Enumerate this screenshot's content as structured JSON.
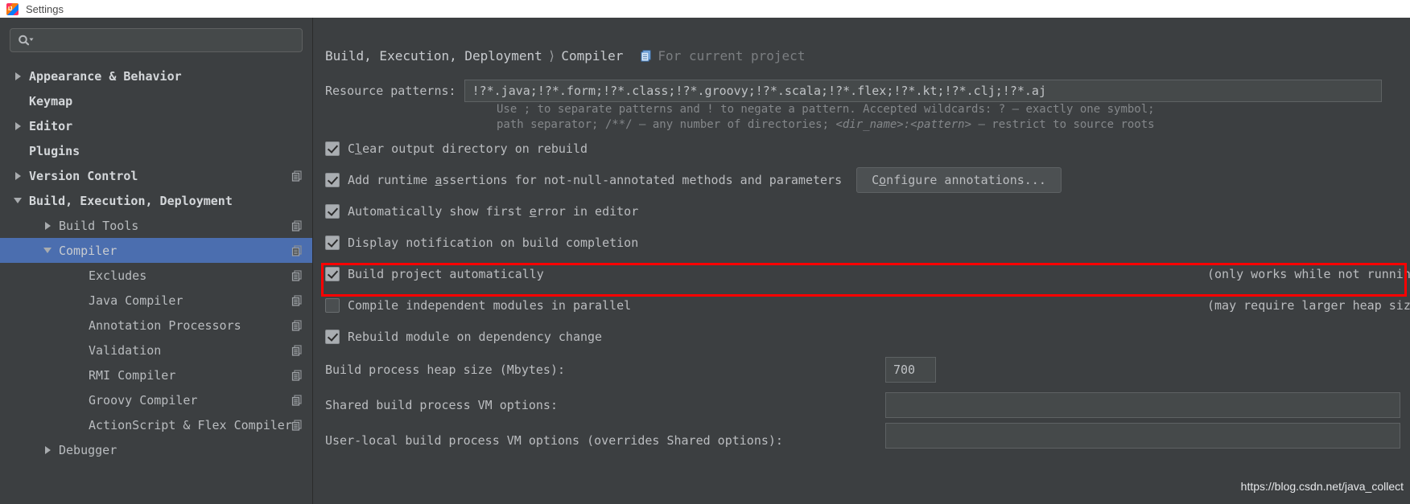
{
  "window": {
    "title": "Settings",
    "app_icon": "intellij-idea-logo"
  },
  "sidebar": {
    "search": {
      "placeholder": "",
      "value": "",
      "icon": "search-icon"
    },
    "items": [
      {
        "label": "Appearance & Behavior",
        "arrow": "right",
        "indent": 0,
        "bold": true,
        "selected": false,
        "badge": false
      },
      {
        "label": "Keymap",
        "arrow": "none",
        "indent": 0,
        "bold": true,
        "selected": false,
        "badge": false
      },
      {
        "label": "Editor",
        "arrow": "right",
        "indent": 0,
        "bold": true,
        "selected": false,
        "badge": false
      },
      {
        "label": "Plugins",
        "arrow": "none",
        "indent": 0,
        "bold": true,
        "selected": false,
        "badge": false
      },
      {
        "label": "Version Control",
        "arrow": "right",
        "indent": 0,
        "bold": true,
        "selected": false,
        "badge": true
      },
      {
        "label": "Build, Execution, Deployment",
        "arrow": "down",
        "indent": 0,
        "bold": true,
        "selected": false,
        "badge": false
      },
      {
        "label": "Build Tools",
        "arrow": "right",
        "indent": 1,
        "bold": false,
        "selected": false,
        "badge": true
      },
      {
        "label": "Compiler",
        "arrow": "down",
        "indent": 1,
        "bold": false,
        "selected": true,
        "badge": true
      },
      {
        "label": "Excludes",
        "arrow": "none",
        "indent": 2,
        "bold": false,
        "selected": false,
        "badge": true
      },
      {
        "label": "Java Compiler",
        "arrow": "none",
        "indent": 2,
        "bold": false,
        "selected": false,
        "badge": true
      },
      {
        "label": "Annotation Processors",
        "arrow": "none",
        "indent": 2,
        "bold": false,
        "selected": false,
        "badge": true
      },
      {
        "label": "Validation",
        "arrow": "none",
        "indent": 2,
        "bold": false,
        "selected": false,
        "badge": true
      },
      {
        "label": "RMI Compiler",
        "arrow": "none",
        "indent": 2,
        "bold": false,
        "selected": false,
        "badge": true
      },
      {
        "label": "Groovy Compiler",
        "arrow": "none",
        "indent": 2,
        "bold": false,
        "selected": false,
        "badge": true
      },
      {
        "label": "ActionScript & Flex Compiler",
        "arrow": "none",
        "indent": 2,
        "bold": false,
        "selected": false,
        "badge": true
      },
      {
        "label": "Debugger",
        "arrow": "right",
        "indent": 1,
        "bold": false,
        "selected": false,
        "badge": false
      }
    ]
  },
  "breadcrumb": {
    "root": "Build, Execution, Deployment",
    "separator": "⟩",
    "leaf": "Compiler",
    "scope_icon": "project-scope-icon",
    "scope_text": "For current project"
  },
  "form": {
    "resource_patterns_label": "Resource patterns:",
    "resource_patterns_value": "!?*.java;!?*.form;!?*.class;!?*.groovy;!?*.scala;!?*.flex;!?*.kt;!?*.clj;!?*.aj",
    "help_line_1": "Use ; to separate patterns and ! to negate a pattern. Accepted wildcards: ? — exactly one symbol;",
    "help_line_2_a": "path separator; /**/ — any number of directories; ",
    "help_line_2_b": "<dir_name>:<pattern>",
    "help_line_2_c": " — restrict to source roots",
    "checkboxes": [
      {
        "label_pre": "C",
        "label_mnemonic": "l",
        "label_post": "ear output directory on rebuild",
        "checked": true,
        "hint": ""
      },
      {
        "label_pre": "Add runtime ",
        "label_mnemonic": "a",
        "label_post": "ssertions for not-null-annotated methods and parameters",
        "checked": true,
        "hint": ""
      },
      {
        "label_pre": "Automatically show first ",
        "label_mnemonic": "e",
        "label_post": "rror in editor",
        "checked": true,
        "hint": ""
      },
      {
        "label_pre": "Display notification on build completion",
        "label_mnemonic": "",
        "label_post": "",
        "checked": true,
        "hint": ""
      },
      {
        "label_pre": "Build project automatically",
        "label_mnemonic": "",
        "label_post": "",
        "checked": true,
        "hint": "(only works while not running / debugging)"
      },
      {
        "label_pre": "Compile independent modules in parallel",
        "label_mnemonic": "",
        "label_post": "",
        "checked": false,
        "hint": "(may require larger heap size)"
      },
      {
        "label_pre": "Rebuild module on dependency change",
        "label_mnemonic": "",
        "label_post": "",
        "checked": true,
        "hint": ""
      }
    ],
    "configure_annotations_pre": "C",
    "configure_annotations_mnemonic": "o",
    "configure_annotations_post": "nfigure annotations...",
    "heap_label": "Build process heap size (Mbytes):",
    "heap_value": "700",
    "shared_vm_label": "Shared build process VM options:",
    "shared_vm_value": "",
    "user_vm_label": "User-local build process VM options (overrides Shared options):",
    "user_vm_value": ""
  },
  "watermark": {
    "text": "https://blog.csdn.net/java_collect"
  },
  "colors": {
    "selection": "#4b6eaf",
    "annotation": "#ff0000",
    "panel_bg": "#3c3f41",
    "input_bg": "#45494a"
  }
}
